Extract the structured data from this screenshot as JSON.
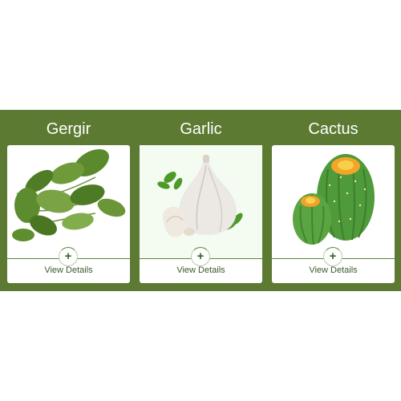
{
  "products": [
    {
      "name": "Gergir",
      "action_label": "View Details",
      "plus_symbol": "+",
      "icon": "arugula-leaves-image"
    },
    {
      "name": "Garlic",
      "action_label": "View Details",
      "plus_symbol": "+",
      "icon": "garlic-bulb-image"
    },
    {
      "name": "Cactus",
      "action_label": "View Details",
      "plus_symbol": "+",
      "icon": "cactus-image"
    }
  ],
  "colors": {
    "band_background": "#5c7a32",
    "card_background": "#ffffff",
    "accent_green": "#2f6b1e",
    "title_text": "#ffffff"
  }
}
